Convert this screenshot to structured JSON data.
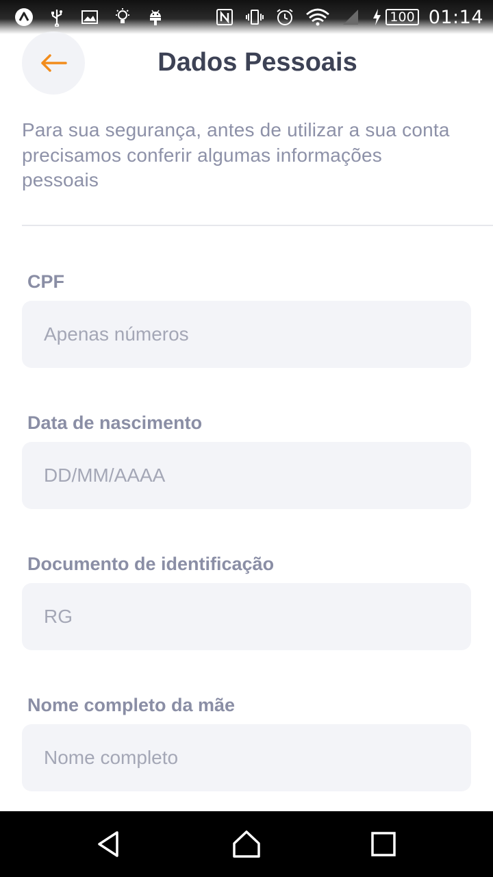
{
  "status_bar": {
    "battery": "100",
    "time": "01:14",
    "left_icons": [
      "app-logo-icon",
      "usb-icon",
      "image-icon",
      "lightbulb-icon",
      "android-icon"
    ],
    "right_icons": [
      "nfc-icon",
      "vibrate-icon",
      "alarm-icon",
      "wifi-icon",
      "signal-icon",
      "charging-icon"
    ]
  },
  "header": {
    "title": "Dados Pessoais",
    "back_icon": "arrow-left-icon",
    "accent_color": "#f28c1c"
  },
  "intro_text": "Para sua segurança, antes de utilizar a sua conta precisamos conferir algumas informações pessoais",
  "form": {
    "cpf": {
      "label": "CPF",
      "placeholder": "Apenas números",
      "value": ""
    },
    "birth_date": {
      "label": "Data de nascimento",
      "placeholder": "DD/MM/AAAA",
      "value": ""
    },
    "id_document": {
      "label": "Documento de identificação",
      "placeholder": "RG",
      "value": ""
    },
    "mother_name": {
      "label": "Nome completo da mãe",
      "placeholder": "Nome completo",
      "value": ""
    }
  },
  "nav_bar": {
    "icons": [
      "back-triangle-icon",
      "home-icon",
      "recents-square-icon"
    ]
  },
  "colors": {
    "title": "#3d4255",
    "label": "#8a8ea5",
    "input_bg": "#f3f4f8",
    "back_button_bg": "#f2f3f7"
  }
}
